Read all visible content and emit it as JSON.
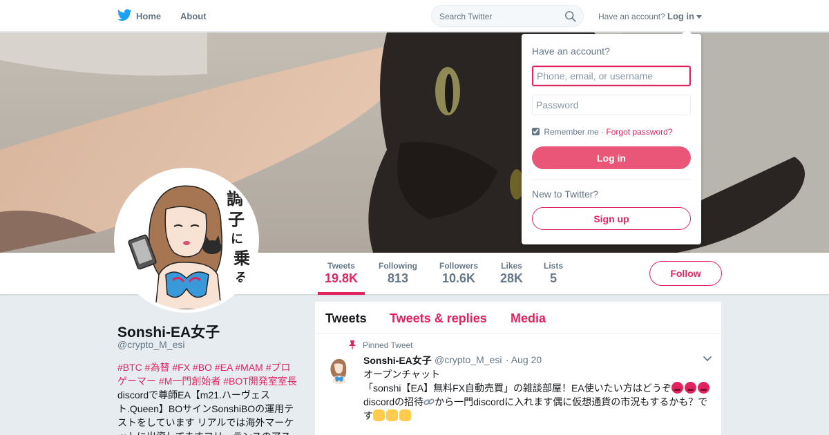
{
  "nav": {
    "home_label": "Home",
    "about_label": "About",
    "search_placeholder": "Search Twitter",
    "have_account": "Have an account?",
    "login_label": "Log in",
    "logo_icon": "twitter-bird-icon",
    "search_icon": "search-icon"
  },
  "profile": {
    "name": "Sonshi-EA女子",
    "handle": "@crypto_M_esi",
    "bio_tags": "#BTC #為替 #FX #BO #EA #MAM #プロゲーマー #M一門創始者 #BOT開発室室長",
    "bio_text": "discordで尊師EA【m21.ハーヴェスト.Queen】BOサインSonshiBOの運用テストをしています リアルでは海外マーケットに出資してますフリーランスのアス",
    "avatar_caption": "調子に乗るな"
  },
  "stats": [
    {
      "label": "Tweets",
      "value": "19.8K"
    },
    {
      "label": "Following",
      "value": "813"
    },
    {
      "label": "Followers",
      "value": "10.6K"
    },
    {
      "label": "Likes",
      "value": "28K"
    },
    {
      "label": "Lists",
      "value": "5"
    }
  ],
  "follow_label": "Follow",
  "timeline": {
    "tabs": [
      "Tweets",
      "Tweets & replies",
      "Media"
    ],
    "pinned_label": "Pinned Tweet",
    "tweet": {
      "name": "Sonshi-EA女子",
      "handle": "@crypto_M_esi",
      "date": "· Aug 20",
      "line1": "オープンチャット",
      "line2": "「sonshi【EA】無料FX自動売買」の雑談部屋！EA使いたい方はどうぞ",
      "line3a": "discordの招待",
      "line3b": "から一門discordに入れます偶に仮想通貨の市況もするかも？で",
      "line4": "す"
    }
  },
  "login_dropdown": {
    "title": "Have an account?",
    "username_placeholder": "Phone, email, or username",
    "password_placeholder": "Password",
    "remember_label": "Remember me",
    "separator": "·",
    "forgot_label": "Forgot password?",
    "login_button": "Log in",
    "new_label": "New to Twitter?",
    "signup_button": "Sign up"
  },
  "colors": {
    "accent": "#e0245e",
    "login_button": "#e95678",
    "background": "#e6ecf0",
    "twitter_blue": "#1da1f2",
    "muted_text": "#657786"
  }
}
